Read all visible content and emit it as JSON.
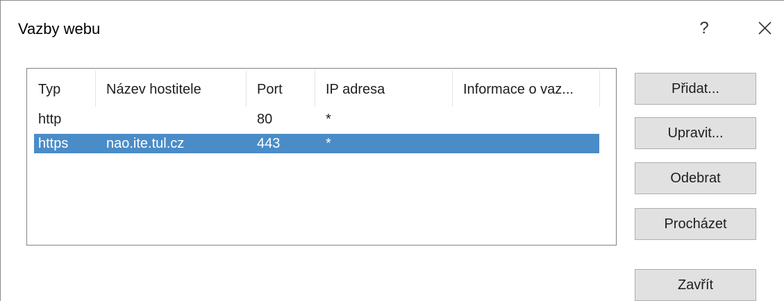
{
  "window": {
    "title": "Vazby webu",
    "help_label": "?",
    "close_icon": "close-icon"
  },
  "columns": [
    "Typ",
    "Název hostitele",
    "Port",
    "IP adresa",
    "Informace o vaz..."
  ],
  "rows": [
    {
      "type": "http",
      "hostname": "",
      "port": "80",
      "ip": "*",
      "info": "",
      "selected": false
    },
    {
      "type": "https",
      "hostname": "nao.ite.tul.cz",
      "port": "443",
      "ip": "*",
      "info": "",
      "selected": true
    }
  ],
  "buttons": {
    "add": "Přidat...",
    "edit": "Upravit...",
    "remove": "Odebrat",
    "browse": "Procházet",
    "close": "Zavřít"
  },
  "colors": {
    "selection": "#4a8cc8",
    "button_face": "#e1e1e1",
    "button_border": "#adadad"
  }
}
